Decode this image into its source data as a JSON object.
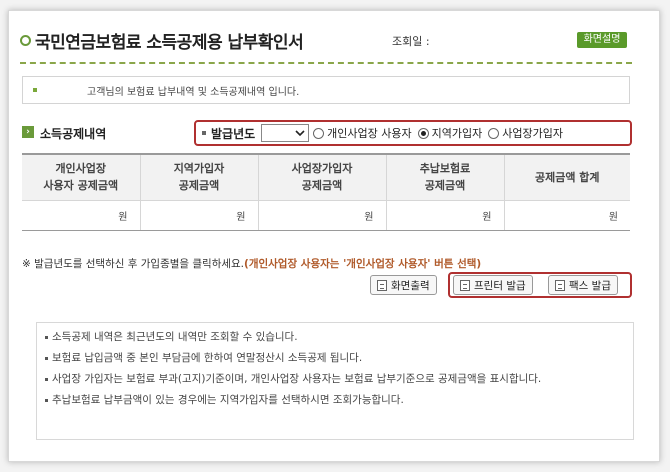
{
  "header": {
    "title": "국민연금보험료 소득공제용 납부확인서",
    "lookup_label": "조회일 :",
    "help_button": "화면설명"
  },
  "notice": {
    "text": "고객님의 보험료 납부내역 및 소득공제내역 입니다."
  },
  "section": {
    "title": "소득공제내역"
  },
  "filter": {
    "year_label": "발급년도",
    "year_selected": "",
    "options": [
      {
        "label": "개인사업장 사용자",
        "checked": false
      },
      {
        "label": "지역가입자",
        "checked": true
      },
      {
        "label": "사업장가입자",
        "checked": false
      }
    ]
  },
  "table": {
    "headers": [
      "개인사업장\n사용자 공제금액",
      "지역가입자\n공제금액",
      "사업장가입자\n공제금액",
      "추납보험료\n공제금액",
      "공제금액 합계"
    ],
    "unit_row": [
      "원",
      "원",
      "원",
      "원",
      "원"
    ]
  },
  "instruction": {
    "text": "※ 발급년도를 선택하신 후 가입종별을 클릭하세요.",
    "emphasis": "(개인사업장 사용자는 '개인사업장 사용자' 버튼 선택)"
  },
  "buttons": {
    "screen_print": "화면출력",
    "printer_issue": "프린터 발급",
    "fax_issue": "팩스 발급"
  },
  "info": {
    "items": [
      "소득공제 내역은 최근년도의 내역만 조회할 수 있습니다.",
      "보험료 납입금액 중 본인 부담금에 한하여 연말정산시 소득공제 됩니다.",
      "사업장 가입자는 보험료 부과(고지)기준이며, 개인사업장 사용자는 보험료 납부기준으로 공제금액을 표시합니다.",
      "추납보험료 납부금액이 있는 경우에는 지역가입자를 선택하시면 조회가능합니다."
    ]
  },
  "colors": {
    "accent_green": "#5a9a2a",
    "highlight_red": "#b03030",
    "emphasis_orange": "#b05a2a"
  }
}
